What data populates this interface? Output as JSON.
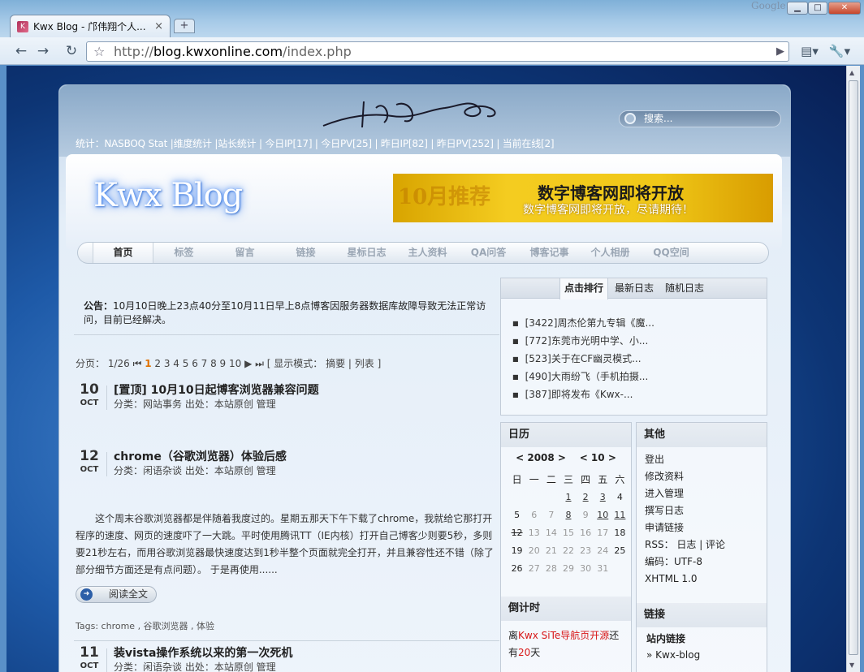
{
  "browser": {
    "tab_title": "Kwx Blog - 邝伟翔个人...",
    "tab_close": "×",
    "newtab": "+",
    "brand": "Google",
    "url_scheme": "http://",
    "url_domain": "blog.kwxonline.com",
    "url_path": "/index.php",
    "min": "▁",
    "max": "□",
    "close": "✕"
  },
  "header": {
    "search_placeholder": "搜索...",
    "stats": "统计：NASBOQ Stat |维度统计 |站长统计 | 今日IP[17] | 今日PV[25] | 昨日IP[82] | 昨日PV[252] | 当前在线[2]",
    "logo": "Kwx Blog",
    "banner_bg": "10月推荐",
    "banner_title": "数字博客网即将开放",
    "banner_sub": "数字博客网即将开放，尽请期待！"
  },
  "nav": [
    "首页",
    "标签",
    "留言",
    "链接",
    "星标日志",
    "主人资料",
    "QA问答",
    "博客记事",
    "个人相册",
    "QQ空间"
  ],
  "notice": {
    "label": "公告：",
    "text": "10月10日晚上23点40分至10月11日早上8点博客因服务器数据库故障导致无法正常访问，目前已经解决。"
  },
  "pager": {
    "prefix": "分页：  1/26 ",
    "first": "⏮",
    "current": "1",
    "pages": " 2 3 4 5 6 7 8 9 10 ",
    "next": "▶",
    "last": "⏭",
    "mode": " [ 显示模式： 摘要 | 列表 ]"
  },
  "posts": [
    {
      "day": "10",
      "month": "OCT",
      "title": "[置顶] 10月10日起博客浏览器兼容问题",
      "meta": "分类：网站事务    出处：本站原创    管理"
    },
    {
      "day": "12",
      "month": "OCT",
      "title": "chrome（谷歌浏览器）体验后感",
      "meta": "分类：闲语杂谈    出处：本站原创    管理"
    },
    {
      "day": "11",
      "month": "OCT",
      "title": "装vista操作系统以来的第一次死机",
      "meta": "分类：闲语杂谈    出处：本站原创    管理"
    }
  ],
  "excerpt": "这个周末谷歌浏览器都是伴随着我度过的。星期五那天下午下载了chrome，我就给它那打开程序的速度、网页的速度吓了一大跳。平时使用腾讯TT（IE内核）打开自己博客少则要5秒，多则要21秒左右，而用谷歌浏览器最快速度达到1秒半整个页面就完全打开，并且兼容性还不错（除了部分细节方面还是有点问题）。  于是再使用......",
  "read_more": "阅读全文",
  "tags": "Tags: chrome , 谷歌浏览器 , 体验",
  "sidebar": {
    "tabs": [
      "点击排行",
      "最新日志",
      "随机日志"
    ],
    "hot": [
      "[3422]周杰伦第九专辑《魔...",
      "[772]东莞市光明中学、小...",
      "[523]关于在CF幽灵模式...",
      "[490]大雨纷飞（手机拍摄...",
      "[387]即将发布《Kwx-..."
    ],
    "calendar_title": "日历",
    "cal_year": "< 2008 >",
    "cal_month": "< 10 >",
    "weekdays": [
      "日",
      "一",
      "二",
      "三",
      "四",
      "五",
      "六"
    ],
    "countdown_title": "倒计时",
    "countdown_a": "离",
    "countdown_link": "Kwx SiTe导航页开源",
    "countdown_b": "还有",
    "countdown_num": "20",
    "countdown_c": "天",
    "other_title": "其他",
    "other_items": [
      "登出",
      "修改资料",
      "进入管理",
      "撰写日志",
      "申请链接",
      "RSS： 日志 | 评论",
      "编码：UTF-8",
      "XHTML 1.0"
    ],
    "links_title": "链接",
    "links_sub": "站内链接",
    "links_item": "» Kwx-blog"
  },
  "colors": {
    "accent": "#e07000",
    "link_red": "#d81818",
    "page_bg": "#1e5aa8"
  }
}
